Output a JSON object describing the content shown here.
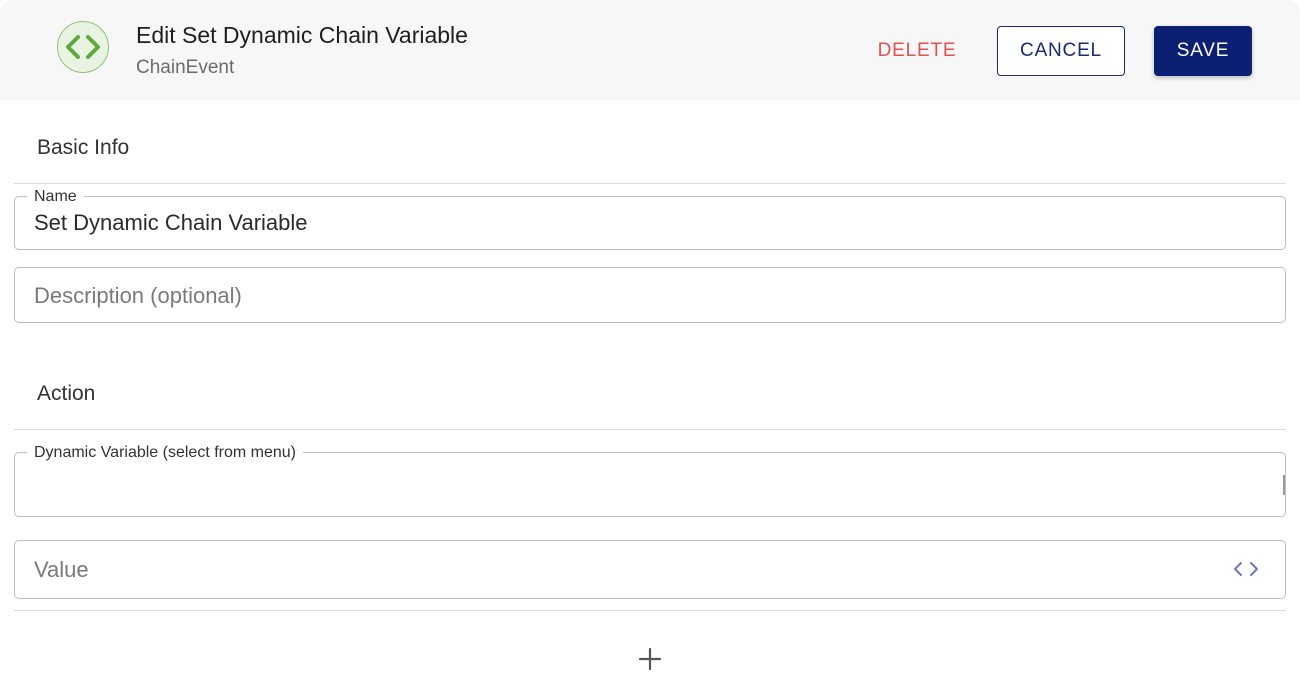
{
  "header": {
    "title": "Edit Set Dynamic Chain Variable",
    "subtitle": "ChainEvent",
    "icon": "code-brackets-icon",
    "delete_label": "DELETE",
    "cancel_label": "CANCEL",
    "save_label": "SAVE"
  },
  "basic_info": {
    "section_title": "Basic Info",
    "name_label": "Name",
    "name_value": "Set Dynamic Chain Variable",
    "description_placeholder": "Description (optional)"
  },
  "action": {
    "section_title": "Action",
    "dynamic_variable_label": "Dynamic Variable (select from menu)",
    "dynamic_variable_value": "",
    "value_placeholder": "Value",
    "value_icon": "code-icon",
    "add_icon": "plus-icon"
  },
  "colors": {
    "brand_primary": "#0b1f73",
    "delete": "#e05252",
    "icon_green": "#5fa83f",
    "code_icon": "#6a78b8"
  }
}
